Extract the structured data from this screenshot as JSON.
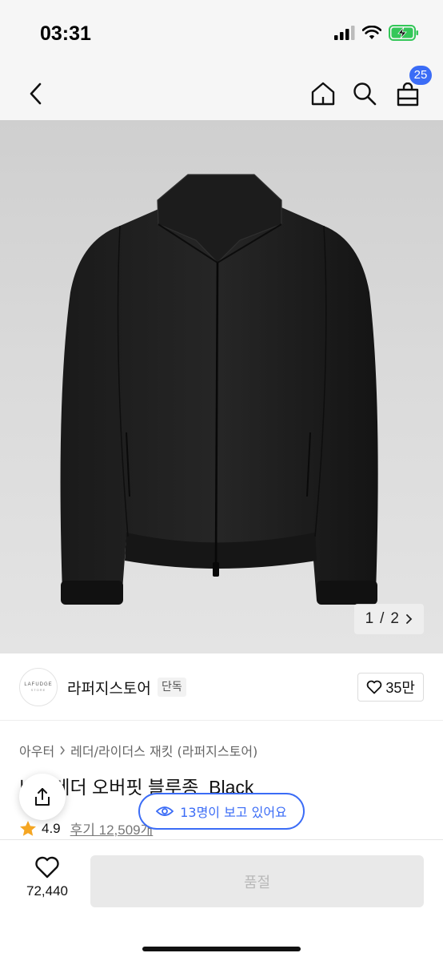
{
  "status_bar": {
    "time": "03:31"
  },
  "nav": {
    "cart_count": "25"
  },
  "gallery": {
    "current": "1",
    "separator": "/",
    "total": "2"
  },
  "store": {
    "logo_text": "LAFUDGE",
    "logo_sub": "STORE",
    "name": "라퍼지스토어",
    "badge": "단독",
    "likes": "35만"
  },
  "breadcrumb": {
    "category": "아우터",
    "subcategory": "레더/라이더스 재킷 (라퍼지스토어)"
  },
  "product": {
    "title": "비건레더 오버핏 블루종_Black",
    "rating": "4.9",
    "reviews": "후기 12,509개"
  },
  "viewers": {
    "text": "13명이 보고 있어요"
  },
  "bottom": {
    "wish_count": "72,440",
    "action_label": "품절"
  },
  "colors": {
    "accent": "#3b6cf6",
    "star": "#f5a623",
    "disabled_bg": "#e9e9e9",
    "disabled_text": "#b9b9b9",
    "battery": "#34c759"
  },
  "icons": {
    "back": "back-arrow-icon",
    "home": "home-icon",
    "search": "search-icon",
    "cart": "cart-icon",
    "share": "share-icon",
    "eye": "eye-icon",
    "heart": "heart-icon",
    "star": "star-icon"
  }
}
